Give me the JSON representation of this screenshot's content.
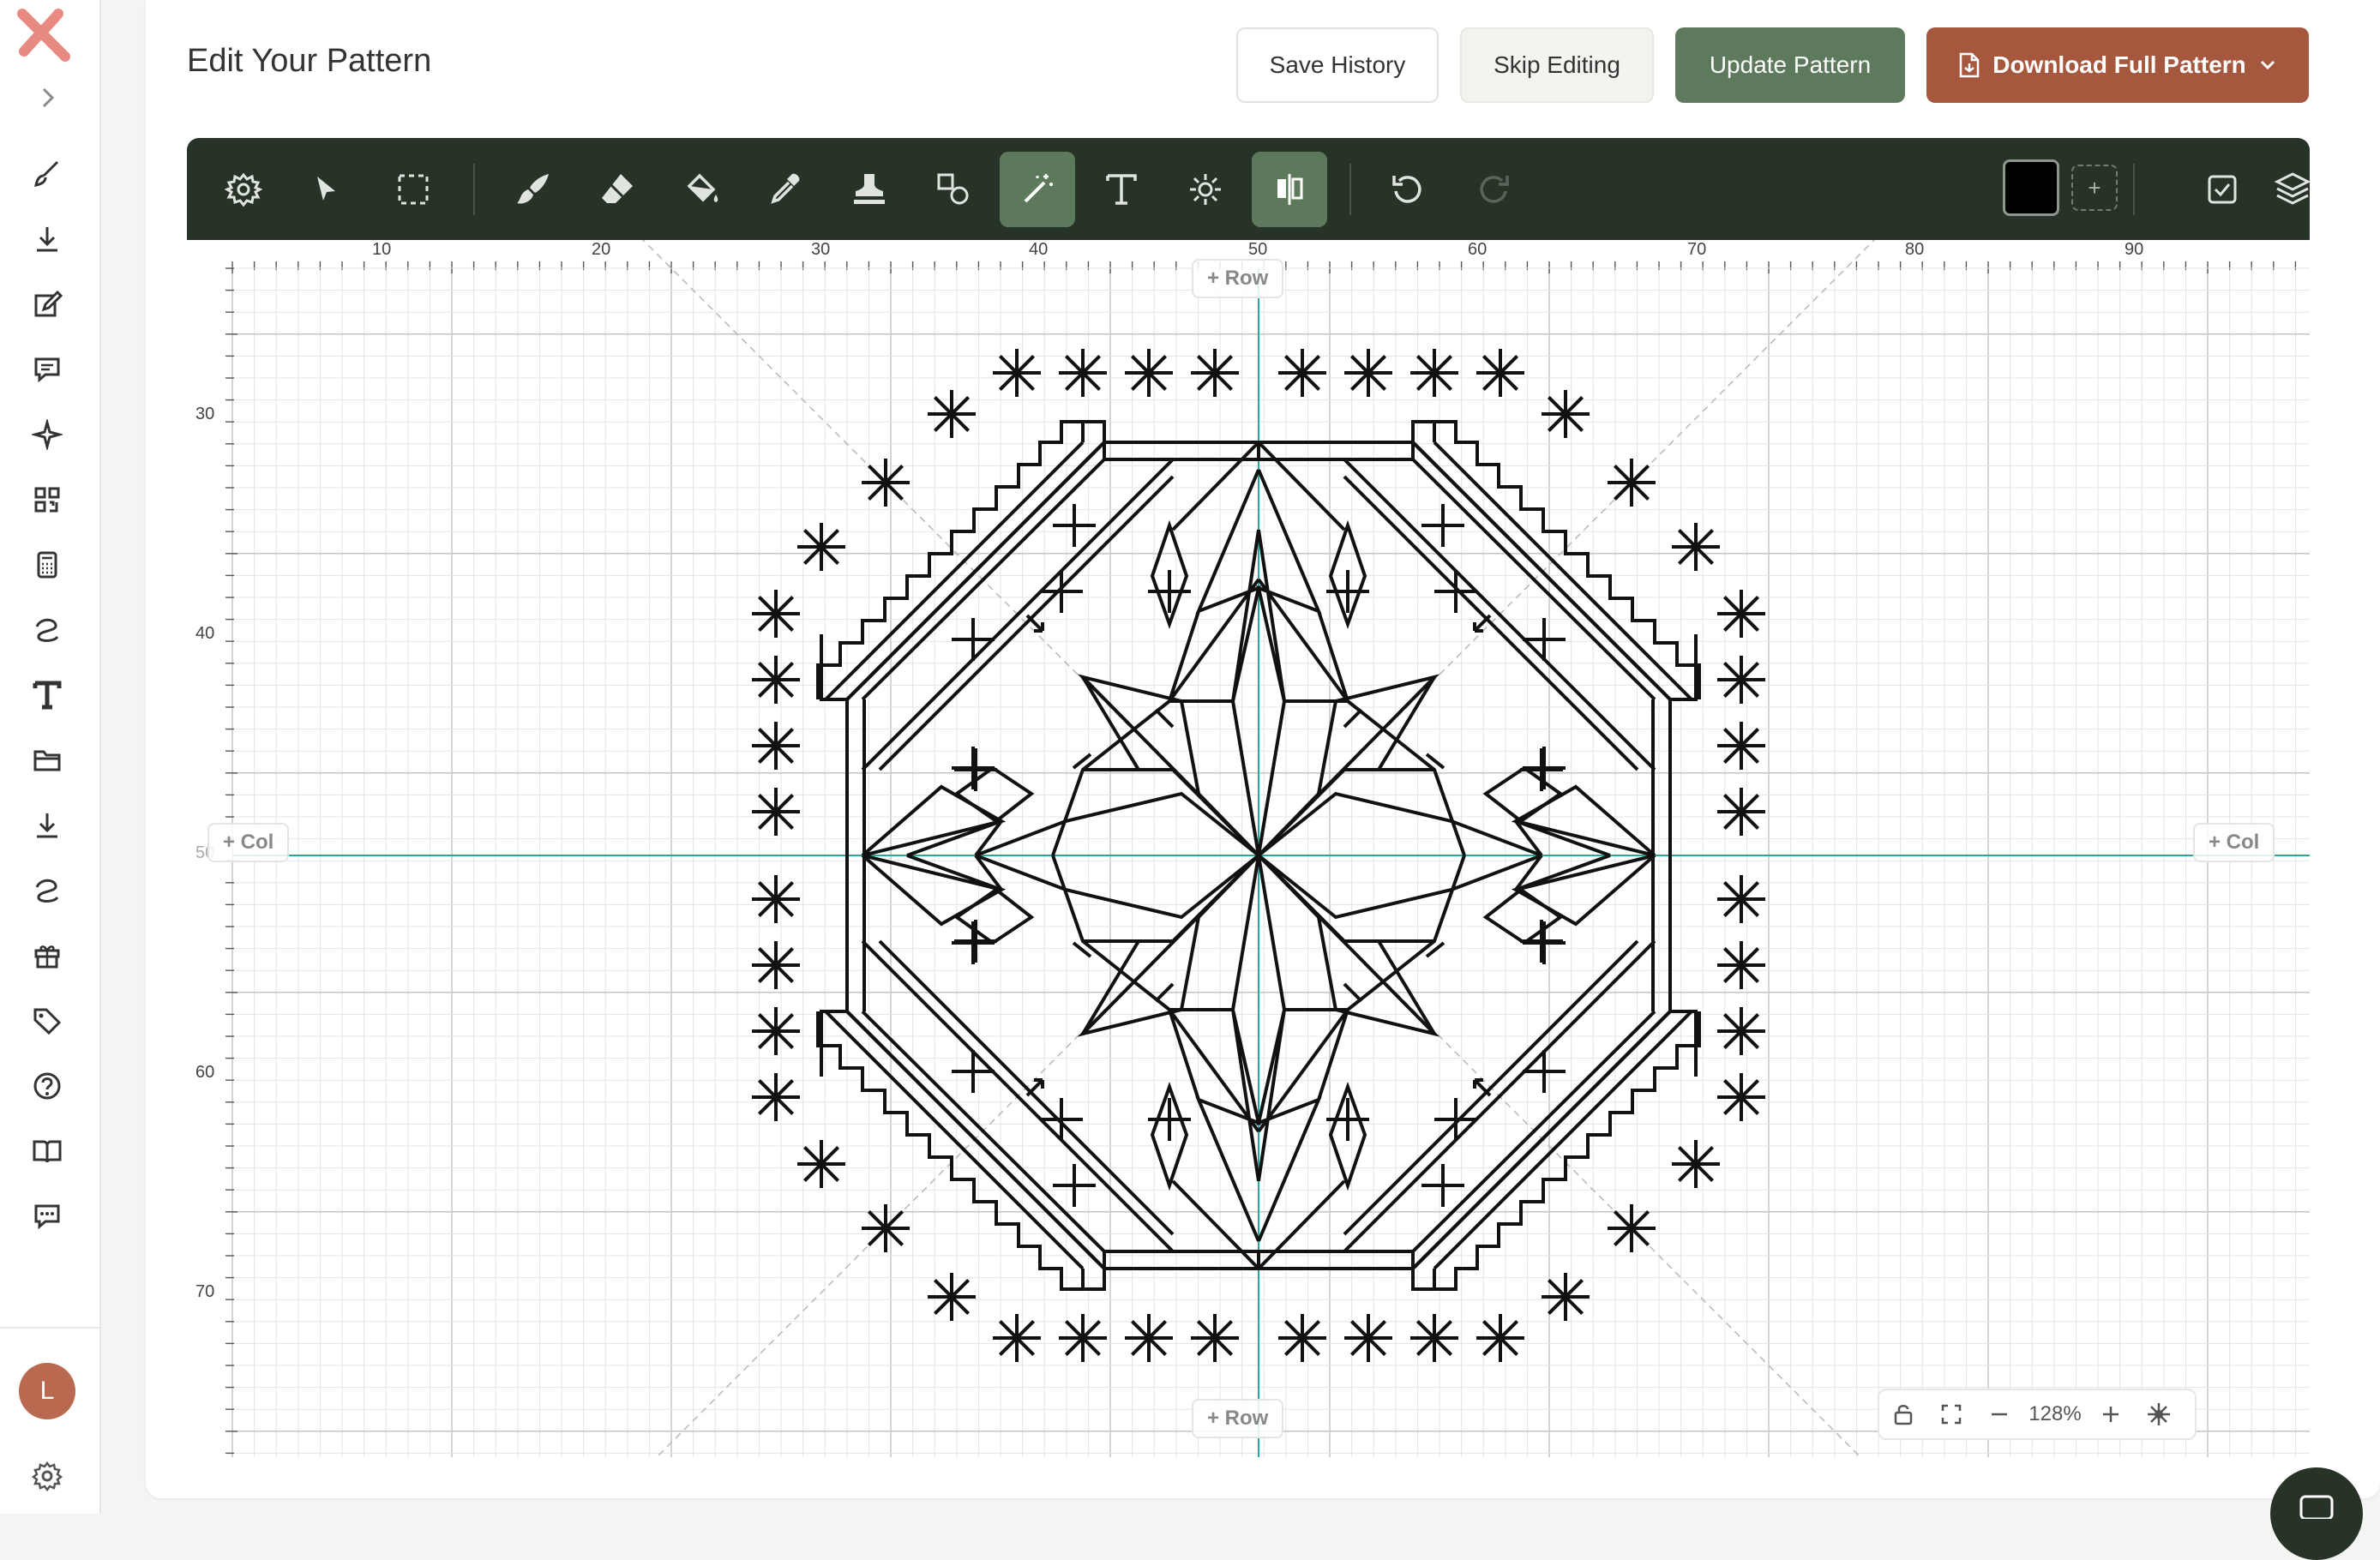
{
  "app": {
    "logo": "x-logo",
    "avatar_initial": "L"
  },
  "header": {
    "title": "Edit Your Pattern"
  },
  "actions": {
    "save_history": "Save History",
    "skip_editing": "Skip Editing",
    "update_pattern": "Update Pattern",
    "download_full_pattern": "Download Full Pattern"
  },
  "sidebar": {
    "items": [
      "brush-icon",
      "download-icon",
      "edit-icon",
      "comment-icon",
      "sparkle-icon",
      "qr-code-icon",
      "calculator-icon",
      "thread-icon",
      "text-icon",
      "folder-icon",
      "download-icon",
      "thread-icon",
      "gift-icon",
      "tag-icon",
      "help-icon",
      "book-icon",
      "chat-icon"
    ]
  },
  "toolbar": {
    "tools": [
      "settings",
      "select",
      "marquee",
      "brush",
      "eraser",
      "fill",
      "eyedropper",
      "stamp",
      "shapes",
      "magic-wand",
      "text",
      "symmetry",
      "mirror",
      "undo",
      "redo"
    ],
    "active_tools": [
      "magic-wand",
      "mirror"
    ],
    "current_color": "#000000",
    "add_color_label": "+"
  },
  "canvas": {
    "ruler_top": [
      "10",
      "20",
      "30",
      "40",
      "50",
      "60",
      "70",
      "80",
      "90"
    ],
    "ruler_left": [
      "30",
      "40",
      "50",
      "60",
      "70"
    ],
    "add_row_label": "+ Row",
    "add_col_label": "+ Col",
    "zoom": "128%"
  },
  "colors": {
    "toolbar_bg": "#283328",
    "accent_green": "#5e7a5c",
    "download_brown": "#a5583e",
    "guide_teal": "#2ea59a"
  }
}
